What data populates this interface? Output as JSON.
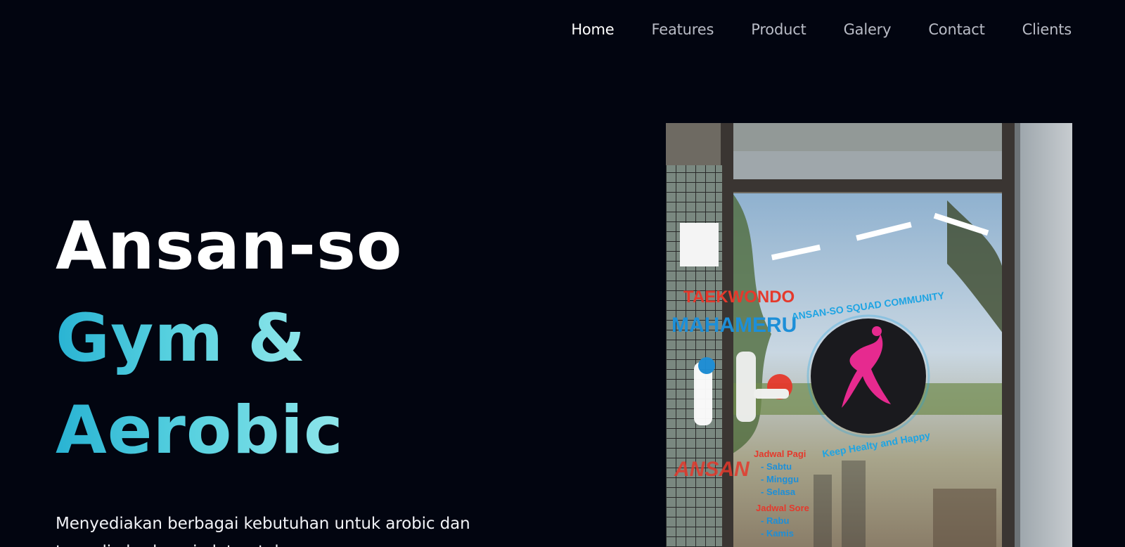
{
  "nav": {
    "items": [
      {
        "label": "Home",
        "active": true
      },
      {
        "label": "Features"
      },
      {
        "label": "Product"
      },
      {
        "label": "Galery"
      },
      {
        "label": "Contact"
      },
      {
        "label": "Clients"
      }
    ]
  },
  "hero": {
    "title_line1": "Ansan-so",
    "title_line2": "Gym &",
    "title_line3": "Aerobic",
    "description": "Menyediakan berbagai kebutuhan untuk arobic dan tersedia berbagai alat untuk gym"
  },
  "photo": {
    "sign_taekwondo": "TAEKWONDO",
    "sign_meru": "MAHAMERU",
    "logo_ring_top": "ANSAN-SO SQUAD COMMUNITY",
    "logo_ring_bottom": "Keep Healty and Happy",
    "schedule": [
      "Jadwal Pagi",
      "- Sabtu",
      "- Minggu",
      "- Selasa",
      "Jadwal Sore",
      "- Rabu",
      "- Kamis"
    ]
  },
  "colors": {
    "background": "#020510",
    "accent_gradient_start": "#29b3d3",
    "accent_gradient_end": "#8fe6ea"
  }
}
